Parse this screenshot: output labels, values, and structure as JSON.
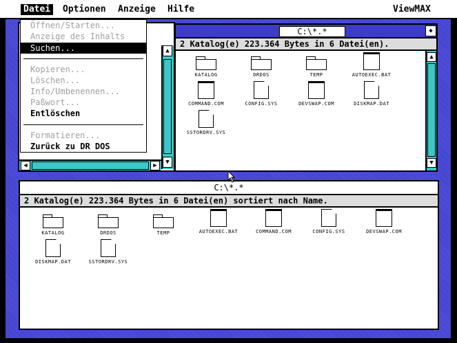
{
  "menubar": {
    "items": [
      {
        "label": "Datei"
      },
      {
        "label": "Optionen"
      },
      {
        "label": "Anzeige"
      },
      {
        "label": "Hilfe"
      }
    ],
    "app_title": "ViewMAX"
  },
  "dropdown": {
    "items": [
      {
        "label": "Öffnen/Starten..."
      },
      {
        "label": "Anzeige des Inhalts"
      },
      {
        "label": "Suchen..."
      },
      {
        "label": "Kopieren..."
      },
      {
        "label": "Löschen..."
      },
      {
        "label": "Info/Umbenennen..."
      },
      {
        "label": "Paßwort..."
      },
      {
        "label": "Entlöschen"
      },
      {
        "label": "Formatieren..."
      },
      {
        "label": "Zurück zu DR DOS"
      }
    ]
  },
  "top_window": {
    "title": "C:\\*.*",
    "status": "2 Katalog(e) 223.364 Bytes in 6 Datei(en).",
    "files": [
      {
        "name": "KATALOG",
        "icon": "folder-icon"
      },
      {
        "name": "DRDOS",
        "icon": "folder-icon"
      },
      {
        "name": "TEMP",
        "icon": "folder-icon"
      },
      {
        "name": "AUTOEXEC.BAT",
        "icon": "batch-file-icon"
      },
      {
        "name": "COMMAND.COM",
        "icon": "program-file-icon"
      },
      {
        "name": "CONFIG.SYS",
        "icon": "document-icon"
      },
      {
        "name": "DEVSWAP.COM",
        "icon": "program-file-icon"
      },
      {
        "name": "DISKMAP.DAT",
        "icon": "document-icon"
      },
      {
        "name": "SSTORDRV.SYS",
        "icon": "document-icon"
      }
    ]
  },
  "bottom_window": {
    "title": "C:\\*.*",
    "status": "2 Katalog(e) 223.364 Bytes in 6 Datei(en) sortiert nach Name.",
    "files": [
      {
        "name": "KATALOG",
        "icon": "folder-icon"
      },
      {
        "name": "DRDOS",
        "icon": "folder-icon"
      },
      {
        "name": "TEMP",
        "icon": "folder-icon"
      },
      {
        "name": "AUTOEXEC.BAT",
        "icon": "batch-file-icon"
      },
      {
        "name": "COMMAND.COM",
        "icon": "program-file-icon"
      },
      {
        "name": "CONFIG.SYS",
        "icon": "document-icon"
      },
      {
        "name": "DEVSWAP.COM",
        "icon": "program-file-icon"
      },
      {
        "name": "DISKMAP.DAT",
        "icon": "document-icon"
      },
      {
        "name": "SSTORDRV.SYS",
        "icon": "document-icon"
      }
    ]
  },
  "colors": {
    "desktop": "#3c3cc8",
    "scrollbar": "#3cc8c8",
    "status_bar": "#dcdcdc"
  }
}
